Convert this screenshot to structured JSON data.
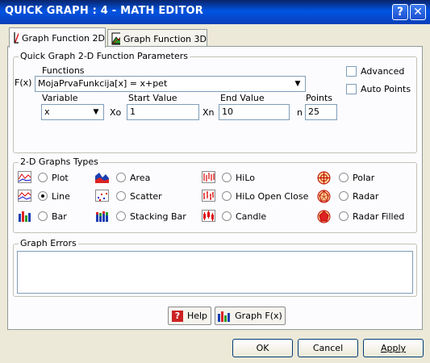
{
  "window": {
    "title": "QUICK GRAPH : 4 - MATH EDITOR",
    "help_glyph": "?",
    "close_glyph": "✕"
  },
  "tabs": [
    {
      "label": "Graph Function 2D",
      "icon": "chart-2d-icon",
      "active": true
    },
    {
      "label": "Graph Function 3D",
      "icon": "chart-3d-icon",
      "active": false
    }
  ],
  "params": {
    "group_title": "Quick Graph 2-D Function Parameters",
    "functions_label": "Functions",
    "fx_label": "F(x)",
    "function_value": "MojaPrvaFunkcija[x] = x+pet",
    "variable_label": "Variable",
    "variable_value": "x",
    "start_label": "Start Value",
    "xo_label": "Xo",
    "start_value": "1",
    "end_label": "End Value",
    "xn_label": "Xn",
    "end_value": "10",
    "points_label": "Points",
    "n_label": "n",
    "points_value": "25",
    "advanced_label": "Advanced",
    "advanced_checked": false,
    "auto_points_label": "Auto Points",
    "auto_points_checked": false
  },
  "types": {
    "group_title": "2-D Graphs Types",
    "selected": "Line",
    "items": [
      {
        "label": "Plot",
        "icon": "plot-icon"
      },
      {
        "label": "Line",
        "icon": "line-icon"
      },
      {
        "label": "Bar",
        "icon": "bar-icon"
      },
      {
        "label": "Area",
        "icon": "area-icon"
      },
      {
        "label": "Scatter",
        "icon": "scatter-icon"
      },
      {
        "label": "Stacking Bar",
        "icon": "stacking-bar-icon"
      },
      {
        "label": "HiLo",
        "icon": "hilo-icon"
      },
      {
        "label": "HiLo Open Close",
        "icon": "hilo-open-close-icon"
      },
      {
        "label": "Candle",
        "icon": "candle-icon"
      },
      {
        "label": "Polar",
        "icon": "polar-icon"
      },
      {
        "label": "Radar",
        "icon": "radar-icon"
      },
      {
        "label": "Radar Filled",
        "icon": "radar-filled-icon"
      }
    ]
  },
  "errors": {
    "group_title": "Graph Errors",
    "text": ""
  },
  "actions": {
    "help_label": "Help",
    "help_glyph": "?",
    "graph_label": "Graph F(x)"
  },
  "footer": {
    "ok_label": "OK",
    "cancel_label": "Cancel",
    "apply_label": "Apply"
  },
  "colors": {
    "title_bar": "#0054e3",
    "face": "#ece9d8",
    "panel": "#fcfcfe",
    "input_border": "#7f9db9"
  }
}
